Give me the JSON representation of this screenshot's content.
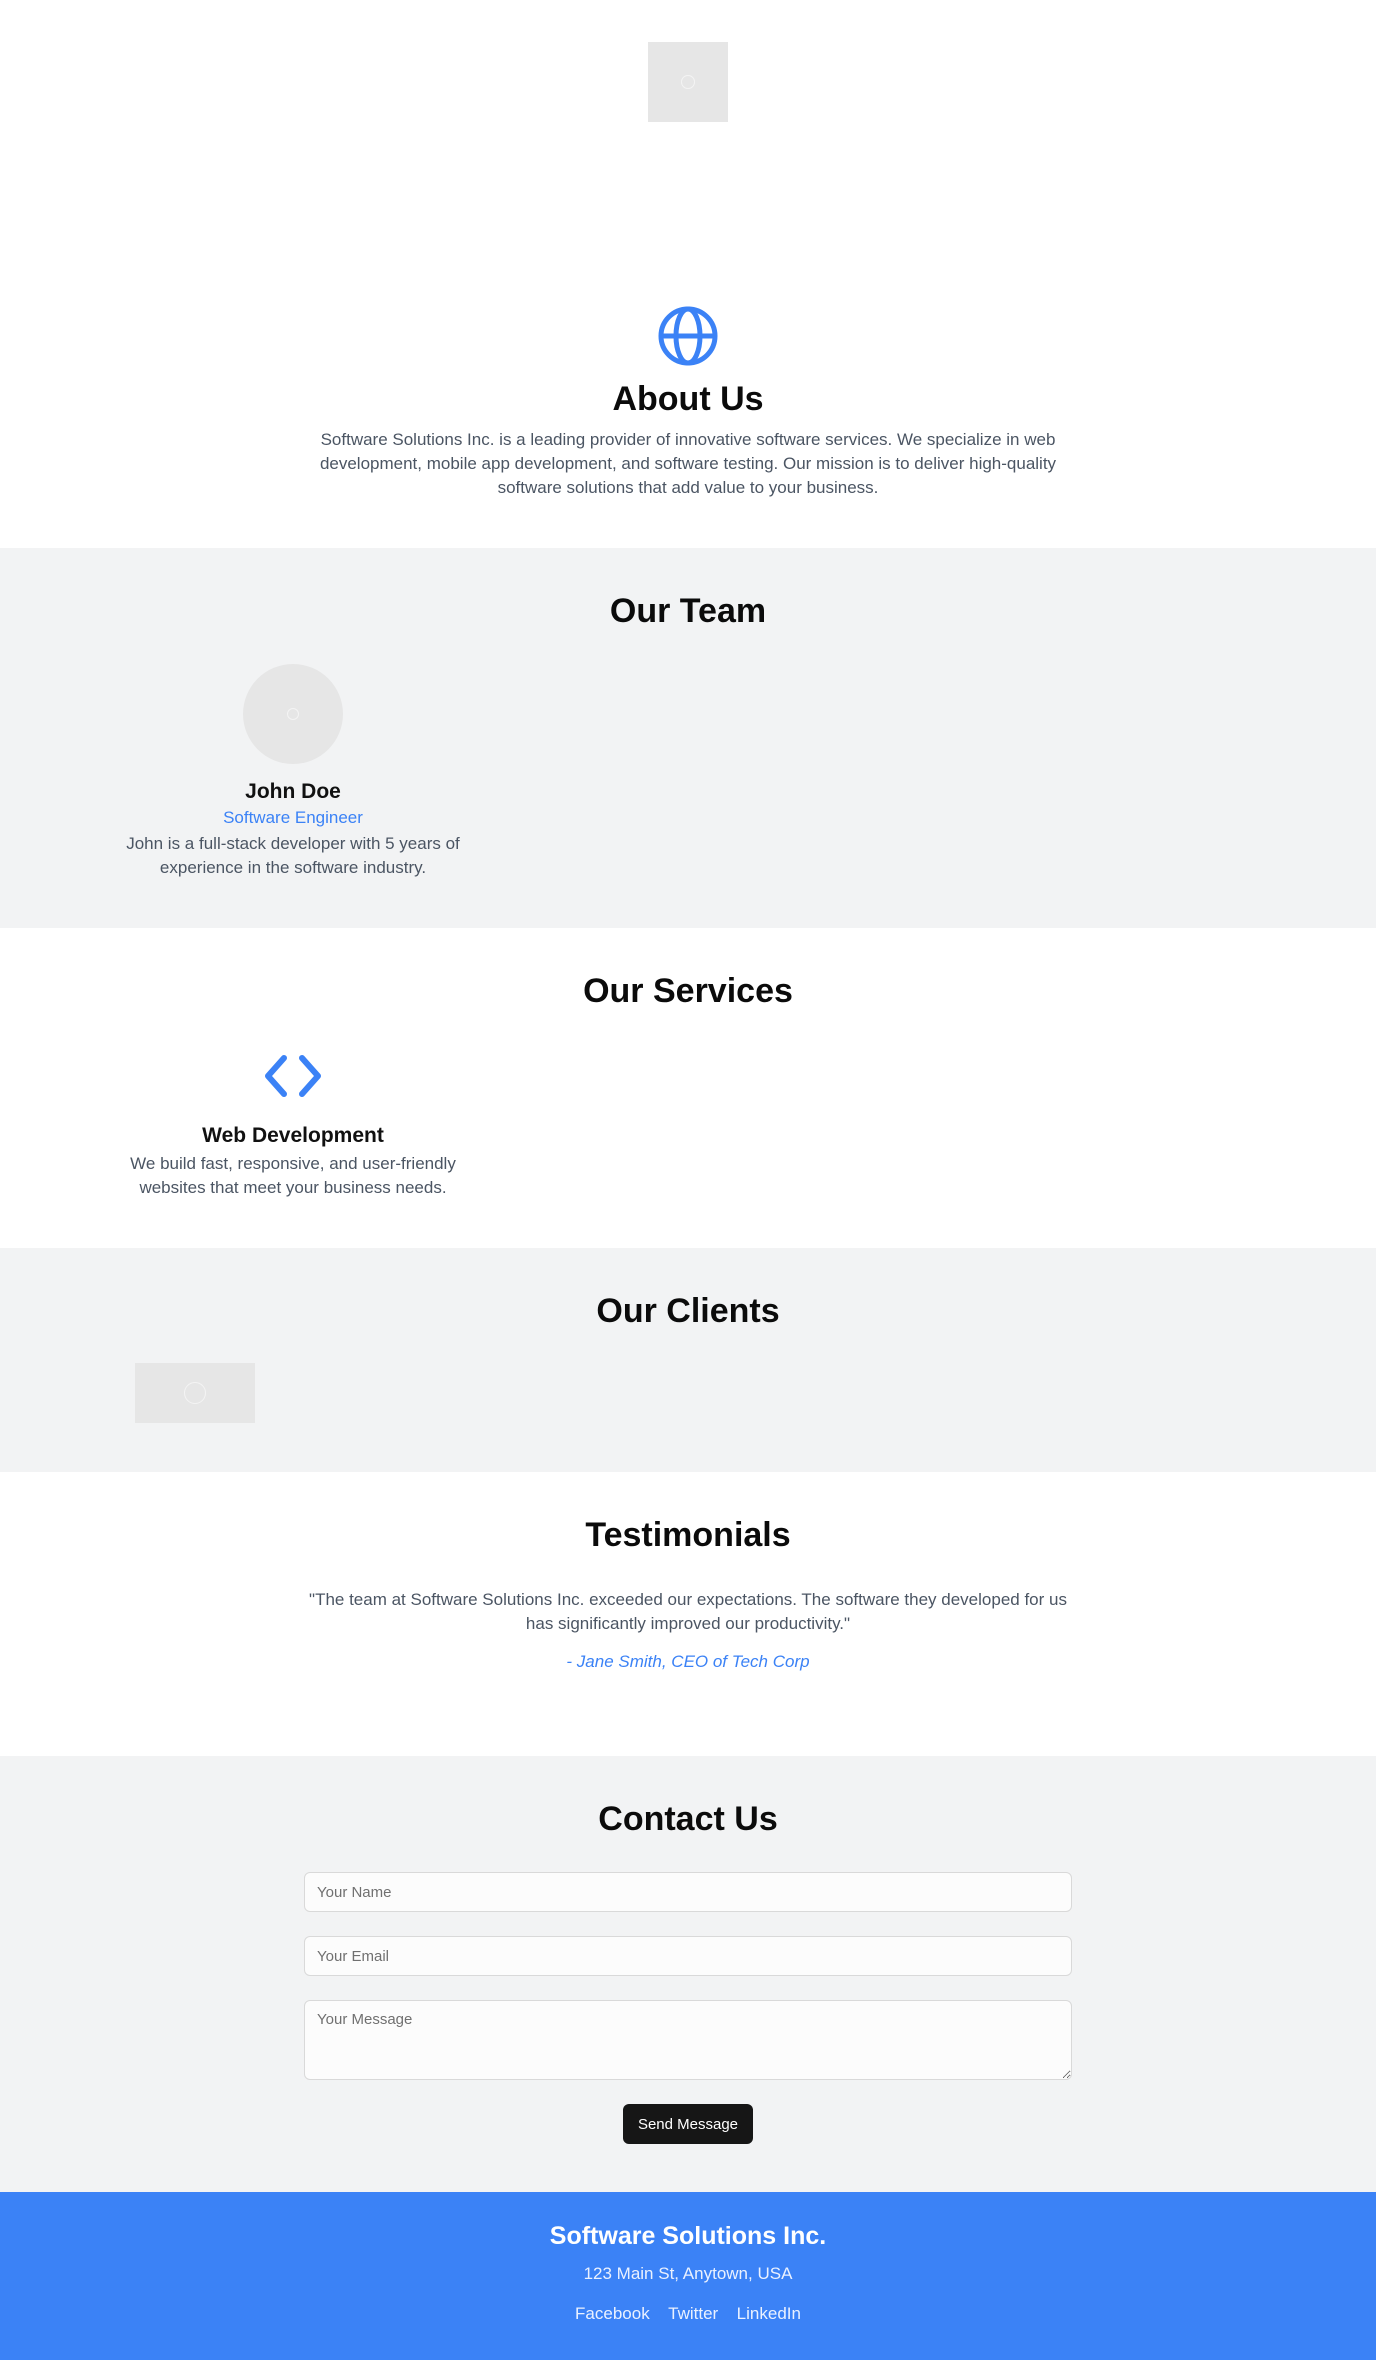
{
  "about": {
    "title": "About Us",
    "text": "Software Solutions Inc. is a leading provider of innovative software services. We specialize in web development, mobile app development, and software testing. Our mission is to deliver high-quality software solutions that add value to your business."
  },
  "team": {
    "title": "Our Team",
    "members": [
      {
        "name": "John Doe",
        "role": "Software Engineer",
        "bio": "John is a full-stack developer with 5 years of experience in the software industry."
      }
    ]
  },
  "services": {
    "title": "Our Services",
    "items": [
      {
        "name": "Web Development",
        "description": "We build fast, responsive, and user-friendly websites that meet your business needs."
      }
    ]
  },
  "clients": {
    "title": "Our Clients"
  },
  "testimonials": {
    "title": "Testimonials",
    "items": [
      {
        "quote": "\"The team at Software Solutions Inc. exceeded our expectations. The software they developed for us has significantly improved our productivity.\"",
        "author": "- Jane Smith, CEO of Tech Corp"
      }
    ]
  },
  "contact": {
    "title": "Contact Us",
    "name_placeholder": "Your Name",
    "email_placeholder": "Your Email",
    "message_placeholder": "Your Message",
    "submit_label": "Send Message"
  },
  "footer": {
    "company": "Software Solutions Inc.",
    "address": "123 Main St, Anytown, USA",
    "links": [
      "Facebook",
      "Twitter",
      "LinkedIn"
    ]
  },
  "colors": {
    "accent": "#3b82f6",
    "section_gray": "#f2f3f4",
    "button_dark": "#161616"
  }
}
